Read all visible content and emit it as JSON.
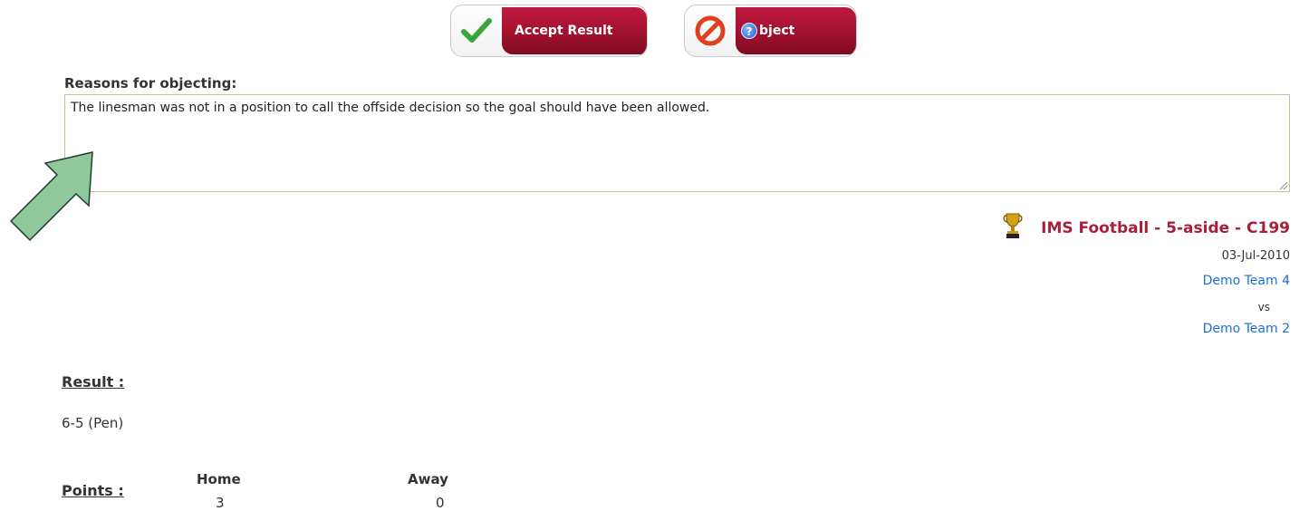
{
  "actions": {
    "accept_label": "Accept Result",
    "object_label": "bject"
  },
  "reasons": {
    "label": "Reasons for objecting:",
    "text": "The linesman was not in a position to call the offside decision so the goal should have been allowed."
  },
  "match": {
    "title": "IMS Football - 5-aside - C199",
    "date": "03-Jul-2010",
    "home_team": "Demo Team 4",
    "vs": "vs",
    "away_team": "Demo Team 2"
  },
  "result": {
    "label": "Result :",
    "value": "6-5 (Pen)"
  },
  "points": {
    "label": "Points :",
    "home_header": "Home",
    "away_header": "Away",
    "home_value": "3",
    "away_value": "0"
  },
  "colors": {
    "accent": "#a81f3a",
    "link": "#1e6fd6",
    "arrow": "#8fc89a"
  }
}
